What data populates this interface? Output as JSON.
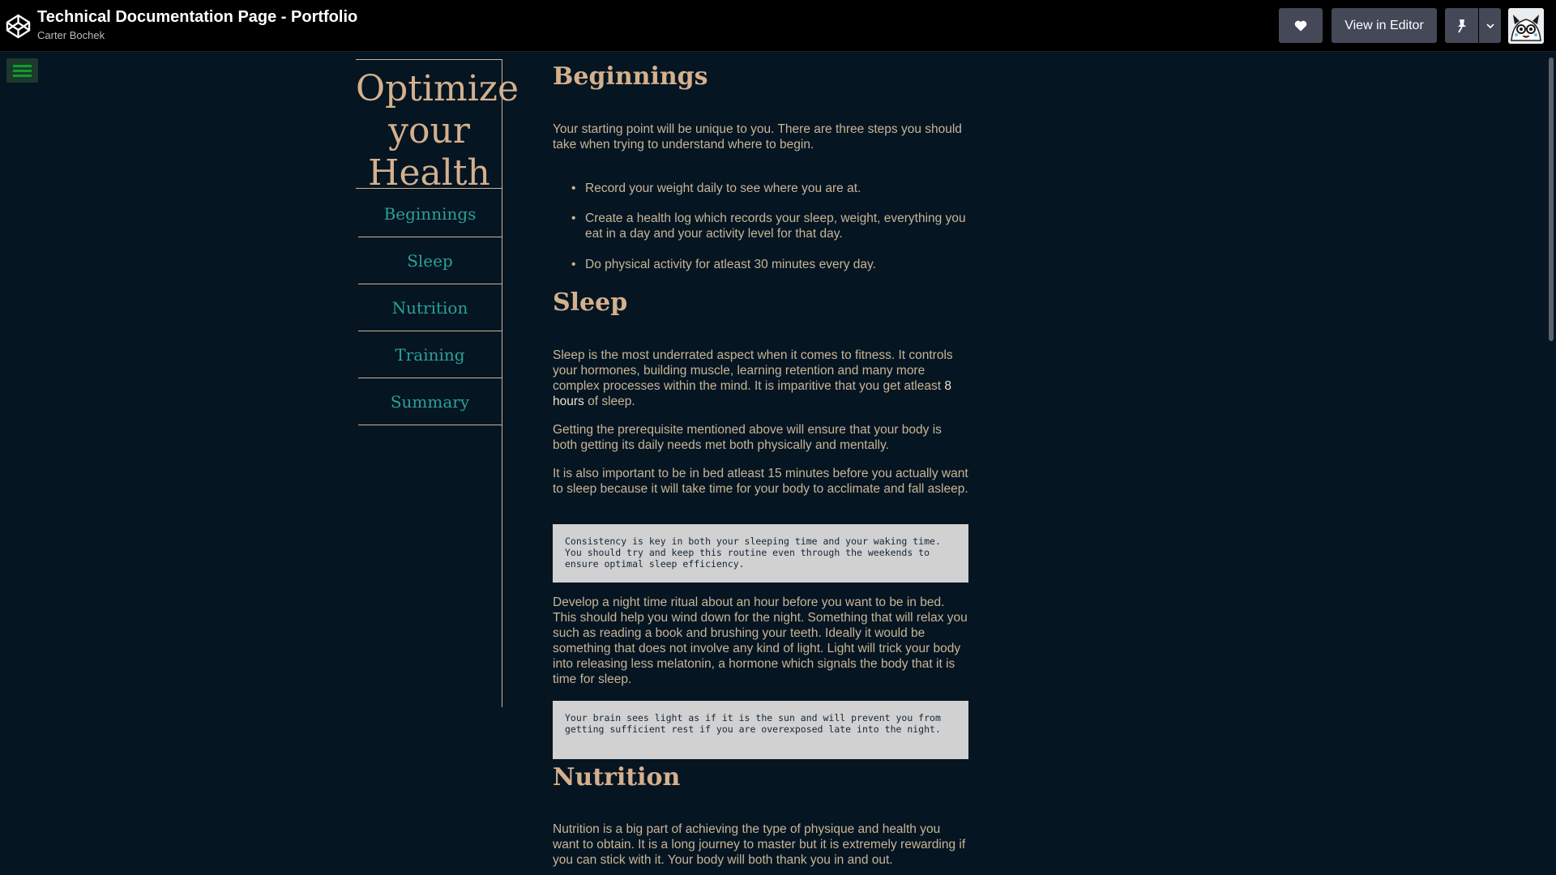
{
  "header": {
    "pen_title": "Technical Documentation Page - Portfolio",
    "author": "Carter Bochek",
    "view_in_editor": "View in Editor",
    "icons": [
      "codepen-logo-icon",
      "heart-icon",
      "pin-icon",
      "chevron-down-icon",
      "user-avatar"
    ]
  },
  "nav": {
    "title_lines": [
      "Optimize",
      "your",
      "Health"
    ],
    "items": [
      "Beginnings",
      "Sleep",
      "Nutrition",
      "Training",
      "Summary"
    ]
  },
  "content": {
    "beginnings": {
      "heading": "Beginnings",
      "intro": "Your starting point will be unique to you. There are three steps you should take when trying to understand where to begin.",
      "steps": [
        "Record your weight daily to see where you are at.",
        "Create a health log which records your sleep, weight, everything you eat in a day and your activity level for that day.",
        "Do physical activity for atleast 30 minutes every day."
      ]
    },
    "sleep": {
      "heading": "Sleep",
      "p1_before": "Sleep is the most underrated aspect when it comes to fitness. It controls your hormones, building muscle, learning retention and many more complex processes within the mind. It is imparitive that you get atleast ",
      "p1_strong": "8 hours",
      "p1_after": " of sleep.",
      "p2": "Getting the prerequisite mentioned above will ensure that your body is both getting its daily needs met both physically and mentally.",
      "p3": "It is also important to be in bed atleast 15 minutes before you actually want to sleep because it will take time for your body to acclimate and fall asleep.",
      "code1": "Consistency is key in both your sleeping time and your waking time. You should try and keep this routine even through the weekends to ensure optimal sleep efficiency.",
      "p4": "Develop a night time ritual about an hour before you want to be in bed. This should help you wind down for the night. Something that will relax you such as reading a book and brushing your teeth. Ideally it would be something that does not involve any kind of light. Light will trick your body into releasing less melatonin, a hormone which signals the body that it is time for sleep.",
      "code2": "Your brain sees light as if it is the sun and will prevent you from getting sufficient rest if you are overexposed late into the night."
    },
    "nutrition": {
      "heading": "Nutrition",
      "p1": "Nutrition is a big part of achieving the type of physique and health you want to obtain. It is a long journey to master but it is extremely rewarding if you can stick with it. Your body will both thank you in and out."
    }
  }
}
